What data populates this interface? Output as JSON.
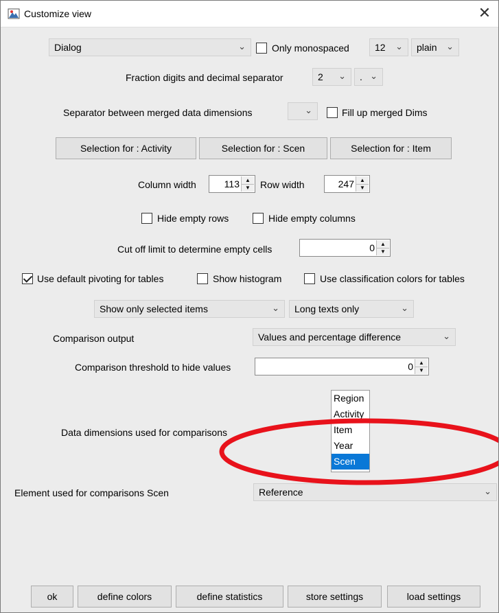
{
  "window": {
    "title": "Customize view",
    "close_glyph": "✕"
  },
  "font": {
    "family": "Dialog",
    "only_monospaced_label": "Only monospaced",
    "size": "12",
    "style": "plain"
  },
  "fraction": {
    "label": "Fraction digits and decimal separator",
    "digits": "2",
    "separator": "."
  },
  "merged": {
    "label": "Separator between merged data dimensions",
    "fill_up_label": "Fill up merged Dims"
  },
  "selection_buttons": [
    "Selection for : Activity",
    "Selection for : Scen",
    "Selection for : Item"
  ],
  "widths": {
    "column_label": "Column width",
    "column_value": "113",
    "row_label": "Row width",
    "row_value": "247"
  },
  "hide": {
    "rows_label": "Hide empty rows",
    "columns_label": "Hide empty columns"
  },
  "cutoff": {
    "label": "Cut off limit to determine empty cells",
    "value": "0"
  },
  "options": {
    "default_pivoting_label": "Use default pivoting for tables",
    "default_pivoting_checked": true,
    "show_histogram_label": "Show histogram",
    "show_histogram_checked": false,
    "classification_colors_label": "Use classification colors for tables",
    "classification_colors_checked": false
  },
  "display": {
    "show_items": "Show only selected items",
    "long_texts": "Long texts only"
  },
  "comparison": {
    "output_label": "Comparison output",
    "output_value": "Values and percentage difference",
    "threshold_label": "Comparison threshold to hide values",
    "threshold_value": "0",
    "dimensions_label": "Data dimensions used for comparisons",
    "dimensions": [
      "Region",
      "Activity",
      "Item",
      "Year",
      "Scen"
    ],
    "selected_dimension": "Scen",
    "element_label": "Element used for comparisons Scen",
    "element_value": "Reference"
  },
  "annotation": {
    "color": "#e8121b",
    "selection_color": "#0a78d7"
  },
  "footer": [
    "ok",
    "define colors",
    "define statistics",
    "store settings",
    "load settings"
  ]
}
